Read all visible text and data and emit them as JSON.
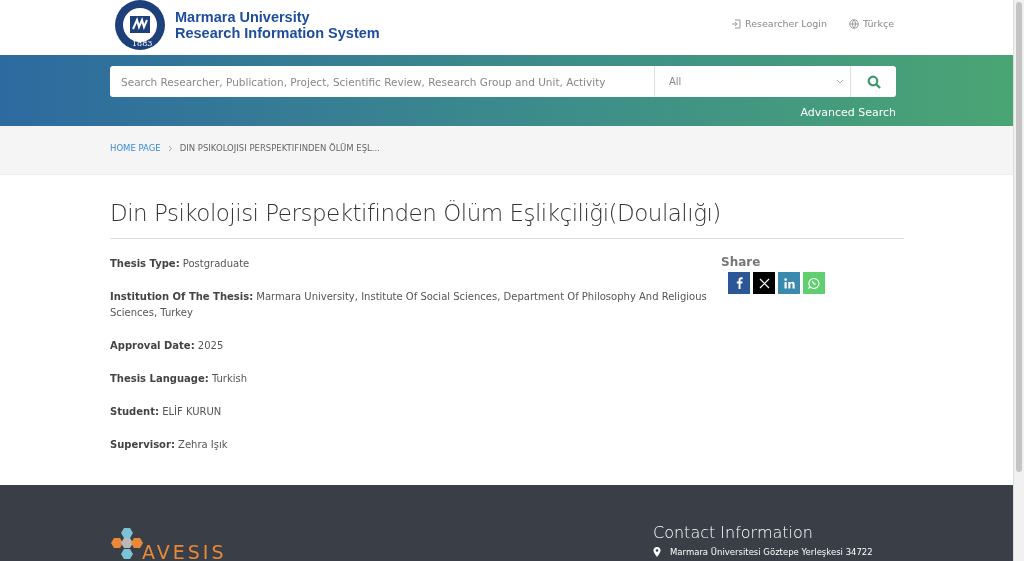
{
  "header": {
    "logo_year": "1883",
    "title_line1": "Marmara University",
    "title_line2": "Research Information System",
    "links": [
      {
        "kind": "login",
        "label": "Researcher Login"
      },
      {
        "kind": "language",
        "label": "Türkçe"
      }
    ]
  },
  "search": {
    "placeholder": "Search Researcher, Publication, Project, Scientific Review, Research Group and Unit, Activity",
    "category": "All",
    "advanced": "Advanced Search"
  },
  "breadcrumb": [
    {
      "label": "HOME PAGE",
      "link": true
    },
    {
      "label": "DIN PSIKOLOJISI PERSPEKTIFINDEN ÖLÜM EŞL...",
      "link": false
    }
  ],
  "title": "Din Psikolojisi Perspektifinden Ölüm Eşlikçiliği(Doulalığı)",
  "fields": [
    {
      "label": "Thesis Type:",
      "value": "Postgraduate"
    },
    {
      "label": "Institution Of The Thesis:",
      "value": "Marmara University, Institute Of Social Sciences, Department Of Philosophy And Religious Sciences, Turkey"
    },
    {
      "label": "Approval Date:",
      "value": "2025"
    },
    {
      "label": "Thesis Language:",
      "value": "Turkish"
    },
    {
      "label": "Student:",
      "value": "ELİF KURUN"
    },
    {
      "label": "Supervisor:",
      "value": "Zehra Işık"
    }
  ],
  "share": {
    "heading": "Share",
    "buttons": [
      {
        "kind": "facebook",
        "color": "#2b5797"
      },
      {
        "kind": "x",
        "color": "#000000"
      },
      {
        "kind": "linkedin",
        "color": "#3a8ab0"
      },
      {
        "kind": "whatsapp",
        "color": "#5fcf70"
      }
    ]
  },
  "footer": {
    "logo_text": "AVESIS",
    "contact_heading": "Contact Information",
    "address": "Marmara Üniversitesi Göztepe Yerleşkesi 34722"
  }
}
